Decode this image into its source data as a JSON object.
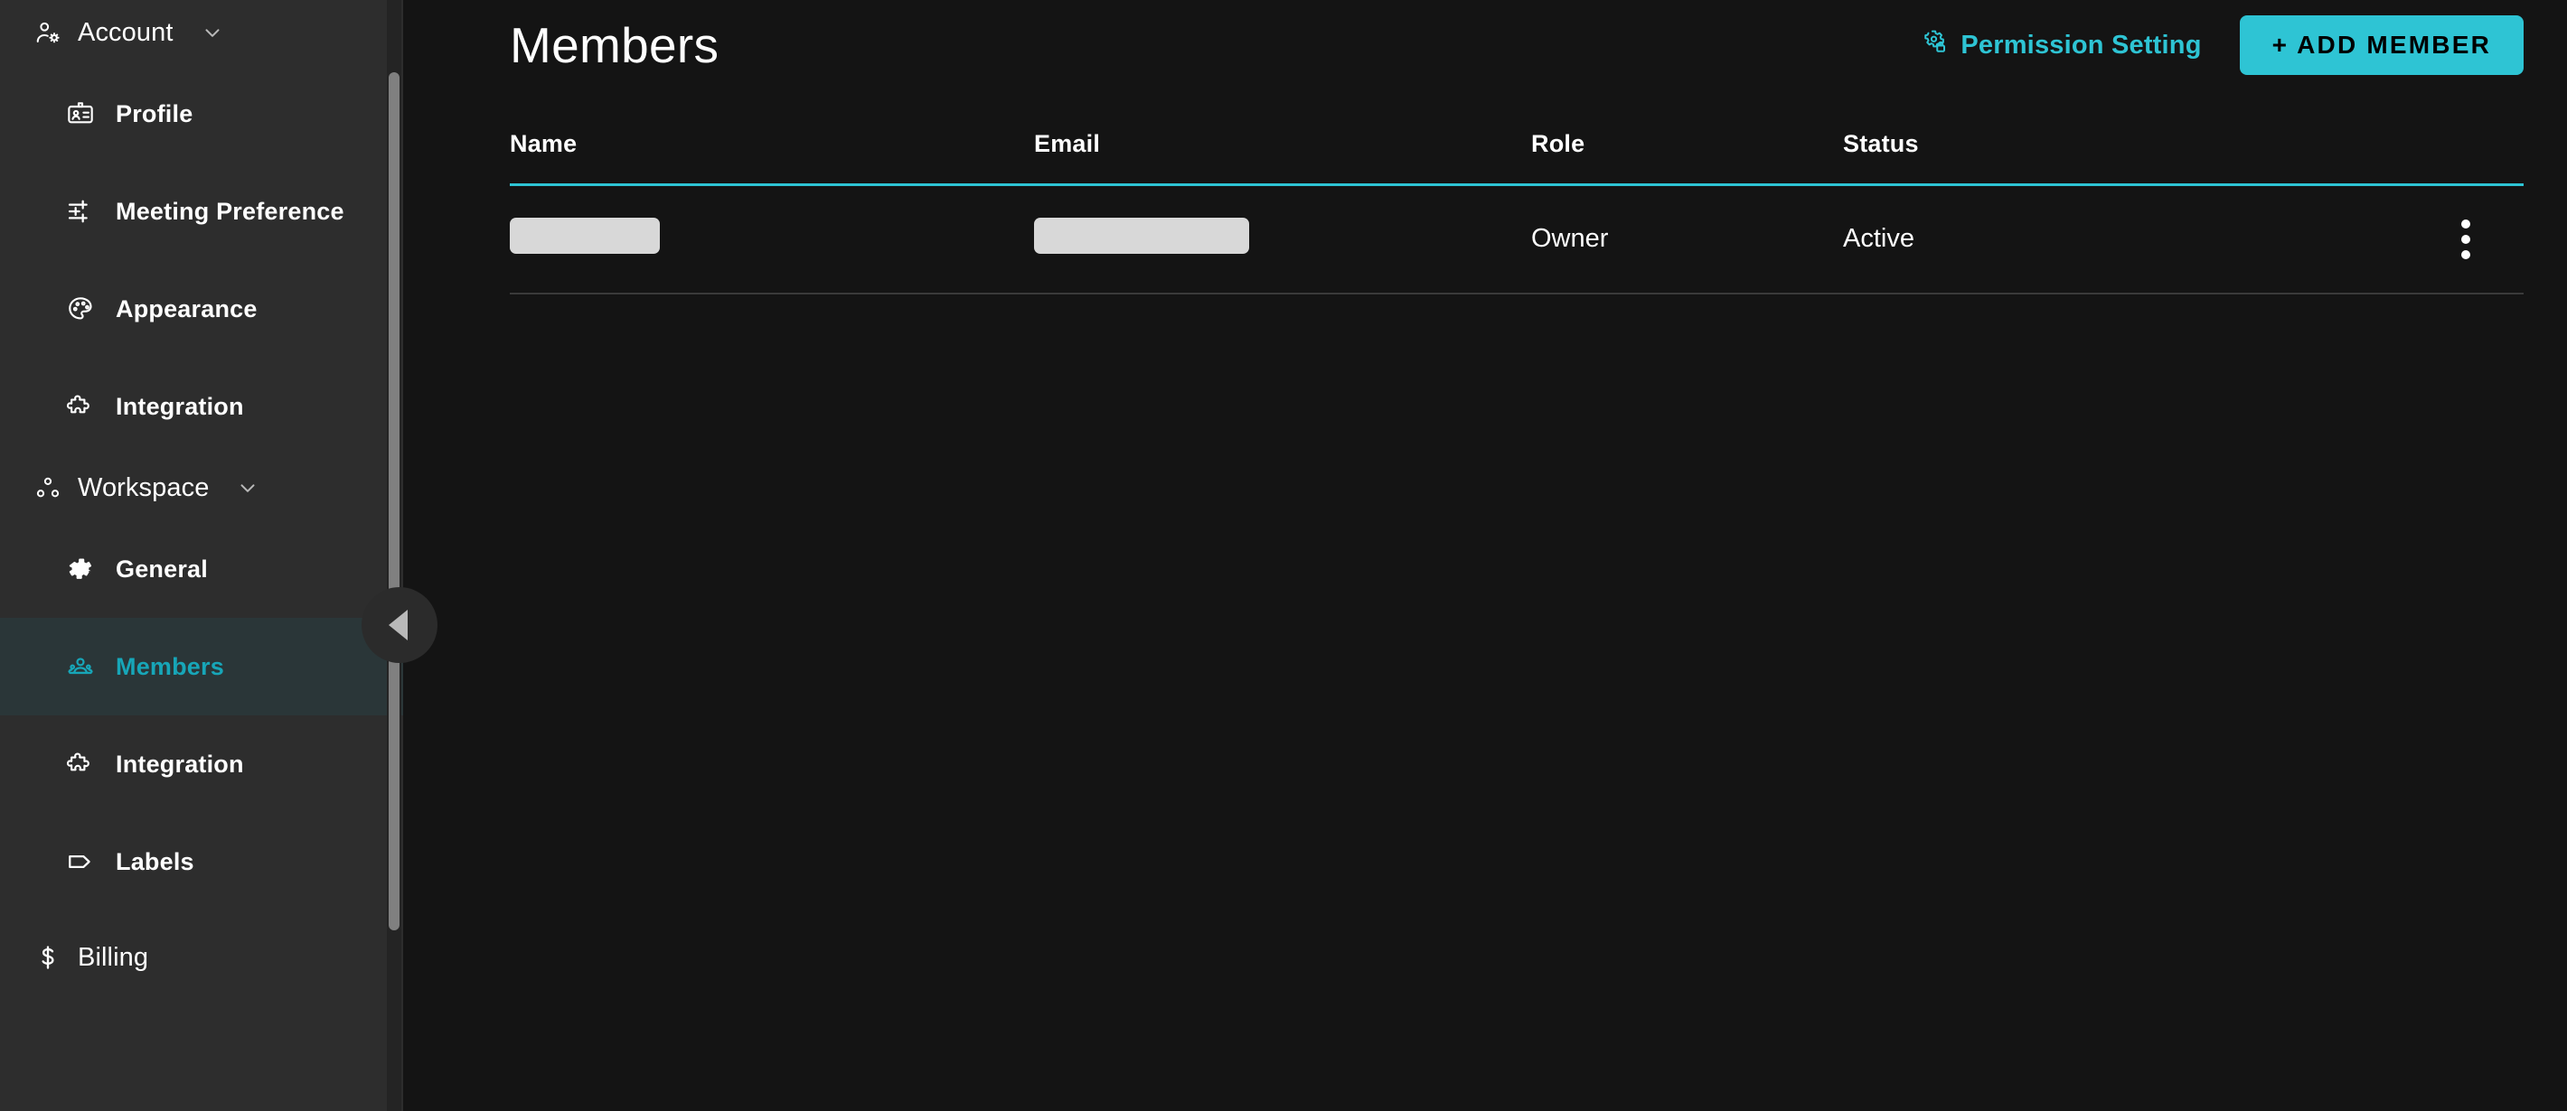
{
  "sidebar": {
    "groups": [
      {
        "label": "Account",
        "icon": "account-gear-icon",
        "chevron": "chevron-down-icon",
        "items": [
          {
            "label": "Profile",
            "icon": "id-badge-icon"
          },
          {
            "label": "Meeting Preference",
            "icon": "sliders-icon"
          },
          {
            "label": "Appearance",
            "icon": "palette-icon"
          },
          {
            "label": "Integration",
            "icon": "puzzle-piece-icon"
          }
        ]
      },
      {
        "label": "Workspace",
        "icon": "workspace-dots-icon",
        "chevron": "chevron-down-icon",
        "items": [
          {
            "label": "General",
            "icon": "gear-icon"
          },
          {
            "label": "Members",
            "icon": "people-icon",
            "active": true
          },
          {
            "label": "Integration",
            "icon": "puzzle-piece-icon"
          },
          {
            "label": "Labels",
            "icon": "tag-icon"
          }
        ]
      }
    ],
    "footer": {
      "label": "Billing",
      "icon": "dollar-icon"
    },
    "collapse_button": "collapse-sidebar-button"
  },
  "header": {
    "title": "Members",
    "permission_setting_label": "Permission Setting",
    "permission_setting_icon": "gear-lock-icon",
    "add_member_label": "+ ADD MEMBER"
  },
  "table": {
    "columns": [
      "Name",
      "Email",
      "Role",
      "Status"
    ],
    "rows": [
      {
        "name": "",
        "name_redacted": true,
        "email": "",
        "email_redacted": true,
        "role": "Owner",
        "status": "Active",
        "menu_icon": "more-vertical-icon"
      }
    ]
  },
  "colors": {
    "accent": "#2ec4d4",
    "accent_muted": "#17a6b8",
    "sidebar_bg": "#2d2d2d",
    "main_bg": "#141414",
    "active_item_bg": "#2a3638",
    "redaction": "#d8d8d8",
    "row_divider": "#3a3a3a",
    "scrollbar_thumb": "#808080"
  }
}
